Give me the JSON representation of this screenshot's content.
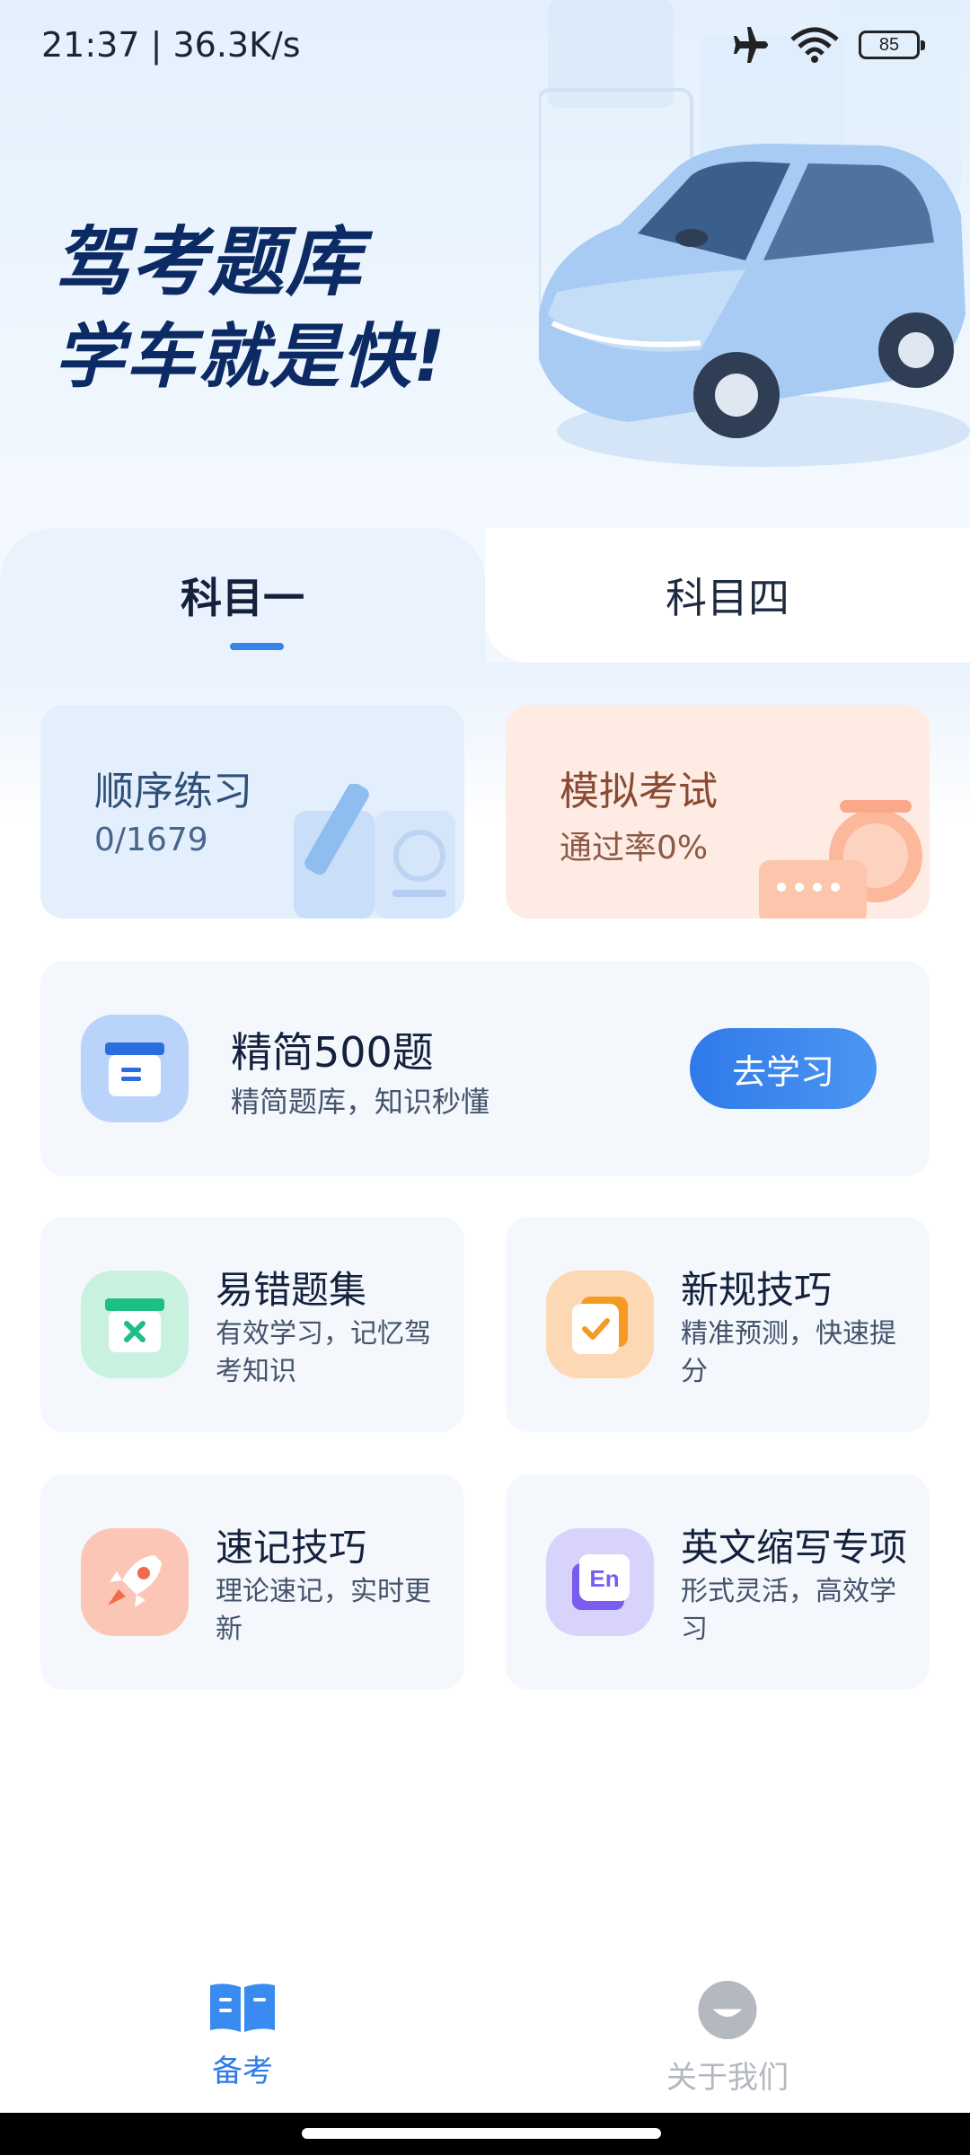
{
  "status_bar": {
    "time": "21:37 | 36.3K/s",
    "battery": "85",
    "icons": [
      "airplane-icon",
      "wifi-icon",
      "battery-icon"
    ]
  },
  "hero": {
    "title": "驾考题库",
    "subtitle": "学车就是快!"
  },
  "tabs": [
    {
      "label": "科目一",
      "active": true
    },
    {
      "label": "科目四",
      "active": false
    }
  ],
  "cards": {
    "sequential": {
      "title": "顺序练习",
      "sub": "0/1679"
    },
    "mock_exam": {
      "title": "模拟考试",
      "sub": "通过率0%"
    }
  },
  "streamlined": {
    "title": "精简500题",
    "sub": "精简题库，知识秒懂",
    "button": "去学习"
  },
  "features": [
    {
      "title": "易错题集",
      "sub": "有效学习，记忆驾考知识",
      "icon": "error-set-icon",
      "color": "#c9f1e0"
    },
    {
      "title": "新规技巧",
      "sub": "精准预测，快速提分",
      "icon": "new-rules-icon",
      "color": "#fcd9b4"
    },
    {
      "title": "速记技巧",
      "sub": "理论速记，实时更新",
      "icon": "rocket-icon",
      "color": "#fbc6b5"
    },
    {
      "title": "英文缩写专项",
      "sub": "形式灵活，高效学习",
      "icon": "english-icon",
      "color": "#d8d3fb"
    }
  ],
  "bottom_nav": [
    {
      "label": "备考",
      "icon": "book-icon",
      "active": true
    },
    {
      "label": "关于我们",
      "icon": "about-icon",
      "active": false
    }
  ],
  "colors": {
    "accent": "#2f7ae9",
    "title_dark": "#0c2a63"
  }
}
